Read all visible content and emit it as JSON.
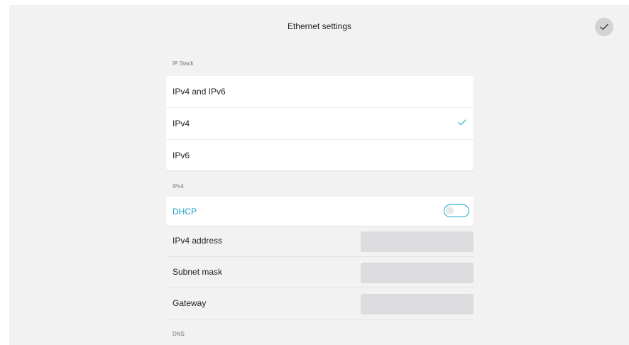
{
  "header": {
    "title": "Ethernet settings",
    "confirm_icon": "checkmark-icon"
  },
  "ip_stack": {
    "section_label": "IP Stack",
    "options": [
      {
        "label": "IPv4 and IPv6",
        "selected": false
      },
      {
        "label": "IPv4",
        "selected": true
      },
      {
        "label": "IPv6",
        "selected": false
      }
    ],
    "selected_icon": "checkmark-icon"
  },
  "ipv4": {
    "section_label": "IPv4",
    "dhcp": {
      "label": "DHCP",
      "enabled": false
    },
    "fields": [
      {
        "label": "IPv4 address",
        "value": ""
      },
      {
        "label": "Subnet mask",
        "value": ""
      },
      {
        "label": "Gateway",
        "value": ""
      }
    ]
  },
  "dns": {
    "section_label": "DNS"
  },
  "colors": {
    "accent": "#1aa3c9",
    "background": "#f2f2f3",
    "card": "#ffffff",
    "input_bg": "#dcdcde"
  }
}
